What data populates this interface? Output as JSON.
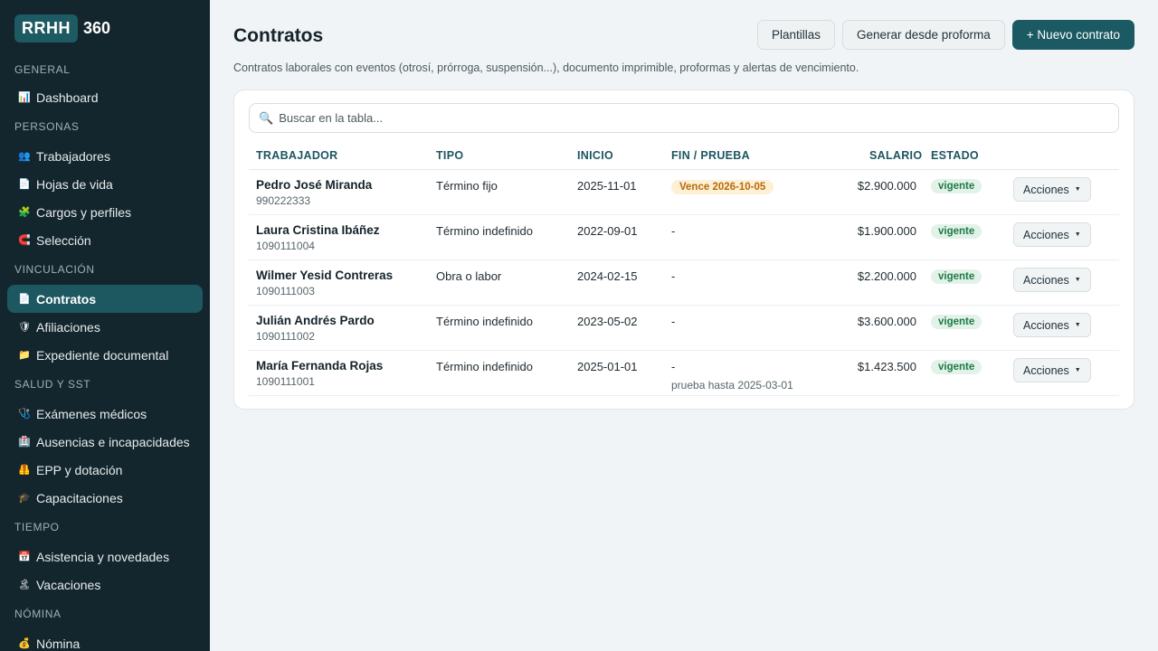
{
  "brand": {
    "box": "RRHH",
    "num": "360"
  },
  "sidebar": {
    "sections": [
      {
        "title": "GENERAL",
        "items": [
          {
            "icon": "chart-icon",
            "glyph": "📊",
            "label": "Dashboard"
          }
        ]
      },
      {
        "title": "PERSONAS",
        "items": [
          {
            "icon": "workers-icon",
            "glyph": "👥",
            "label": "Trabajadores"
          },
          {
            "icon": "document-icon",
            "glyph": "📄",
            "label": "Hojas de vida"
          },
          {
            "icon": "puzzle-icon",
            "glyph": "🧩",
            "label": "Cargos y perfiles"
          },
          {
            "icon": "magnet-icon",
            "glyph": "🧲",
            "label": "Selección"
          }
        ]
      },
      {
        "title": "VINCULACIÓN",
        "items": [
          {
            "icon": "contract-icon",
            "glyph": "📄",
            "label": "Contratos",
            "active": true
          },
          {
            "icon": "shield-icon",
            "glyph": "🛡",
            "label": "Afiliaciones"
          },
          {
            "icon": "folder-icon",
            "glyph": "📁",
            "label": "Expediente documental"
          }
        ]
      },
      {
        "title": "SALUD Y SST",
        "items": [
          {
            "icon": "stethoscope-icon",
            "glyph": "🩺",
            "label": "Exámenes médicos"
          },
          {
            "icon": "absence-icon",
            "glyph": "🏥",
            "label": "Ausencias e incapacidades"
          },
          {
            "icon": "vest-icon",
            "glyph": "🦺",
            "label": "EPP y dotación"
          },
          {
            "icon": "graduation-icon",
            "glyph": "🎓",
            "label": "Capacitaciones"
          }
        ]
      },
      {
        "title": "TIEMPO",
        "items": [
          {
            "icon": "calendar-icon",
            "glyph": "📅",
            "label": "Asistencia y novedades"
          },
          {
            "icon": "vacation-icon",
            "glyph": "🏝",
            "label": "Vacaciones"
          }
        ]
      },
      {
        "title": "NÓMINA",
        "items": [
          {
            "icon": "money-bag-icon",
            "glyph": "💰",
            "label": "Nómina"
          }
        ]
      }
    ]
  },
  "header": {
    "title": "Contratos",
    "subtitle": "Contratos laborales con eventos (otrosí, prórroga, suspensión...), documento imprimible, proformas y alertas de vencimiento.",
    "buttons": {
      "templates": "Plantillas",
      "from_proforma": "Generar desde proforma",
      "new_contract": "+ Nuevo contrato"
    }
  },
  "search": {
    "placeholder": "Buscar en la tabla...",
    "value": ""
  },
  "table": {
    "columns": [
      "TRABAJADOR",
      "TIPO",
      "INICIO",
      "FIN / PRUEBA",
      "SALARIO",
      "ESTADO"
    ],
    "action_label": "Acciones",
    "rows": [
      {
        "name": "Pedro José Miranda",
        "id": "990222333",
        "type": "Término fijo",
        "start": "2025-11-01",
        "end": "Vence 2026-10-05",
        "end_badge": true,
        "trial": "",
        "salary": "$2.900.000",
        "status": "vigente"
      },
      {
        "name": "Laura Cristina Ibáñez",
        "id": "1090111004",
        "type": "Término indefinido",
        "start": "2022-09-01",
        "end": "-",
        "end_badge": false,
        "trial": "",
        "salary": "$1.900.000",
        "status": "vigente"
      },
      {
        "name": "Wilmer Yesid Contreras",
        "id": "1090111003",
        "type": "Obra o labor",
        "start": "2024-02-15",
        "end": "-",
        "end_badge": false,
        "trial": "",
        "salary": "$2.200.000",
        "status": "vigente"
      },
      {
        "name": "Julián Andrés Pardo",
        "id": "1090111002",
        "type": "Término indefinido",
        "start": "2023-05-02",
        "end": "-",
        "end_badge": false,
        "trial": "",
        "salary": "$3.600.000",
        "status": "vigente"
      },
      {
        "name": "María Fernanda Rojas",
        "id": "1090111001",
        "type": "Término indefinido",
        "start": "2025-01-01",
        "end": "-",
        "end_badge": false,
        "trial": "prueba hasta 2025-03-01",
        "salary": "$1.423.500",
        "status": "vigente"
      }
    ]
  },
  "colors": {
    "sidebar": "#14262d",
    "accent": "#1b5a62",
    "warn": "#b96a0a",
    "ok": "#1d7a46"
  }
}
